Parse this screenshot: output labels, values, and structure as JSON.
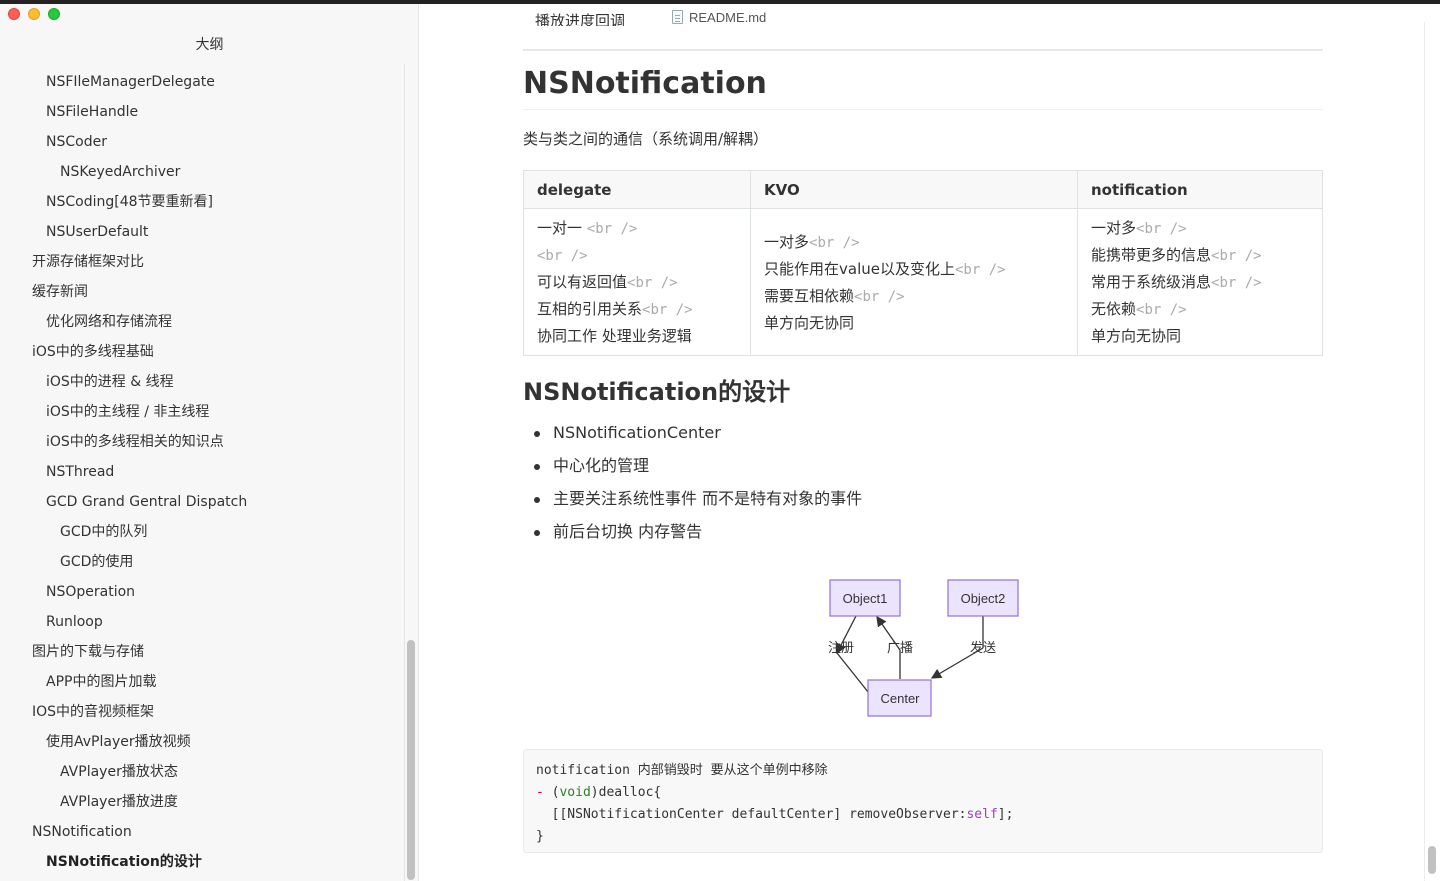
{
  "sidebar": {
    "title": "大纲",
    "items": [
      {
        "label": "NSFIleManagerDelegate",
        "level": 2
      },
      {
        "label": "NSFileHandle",
        "level": 2
      },
      {
        "label": "NSCoder",
        "level": 2
      },
      {
        "label": "NSKeyedArchiver",
        "level": 3
      },
      {
        "label": "NSCoding[48节要重新看]",
        "level": 2
      },
      {
        "label": "NSUserDefault",
        "level": 2
      },
      {
        "label": "开源存储框架对比",
        "level": 1
      },
      {
        "label": "缓存新闻",
        "level": 1
      },
      {
        "label": "优化网络和存储流程",
        "level": 2
      },
      {
        "label": "iOS中的多线程基础",
        "level": 1
      },
      {
        "label": "iOS中的进程 & 线程",
        "level": 2
      },
      {
        "label": "iOS中的主线程 / 非主线程",
        "level": 2
      },
      {
        "label": "iOS中的多线程相关的知识点",
        "level": 2
      },
      {
        "label": "NSThread",
        "level": 2
      },
      {
        "label": "GCD Grand Gentral Dispatch",
        "level": 2
      },
      {
        "label": "GCD中的队列",
        "level": 3
      },
      {
        "label": "GCD的使用",
        "level": 3
      },
      {
        "label": "NSOperation",
        "level": 2
      },
      {
        "label": "Runloop",
        "level": 2
      },
      {
        "label": "图片的下载与存储",
        "level": 1
      },
      {
        "label": "APP中的图片加载",
        "level": 2
      },
      {
        "label": "IOS中的音视频框架",
        "level": 1
      },
      {
        "label": "使用AvPlayer播放视频",
        "level": 2
      },
      {
        "label": "AVPlayer播放状态",
        "level": 3
      },
      {
        "label": "AVPlayer播放进度",
        "level": 3
      },
      {
        "label": "NSNotification",
        "level": 1
      },
      {
        "label": "NSNotification的设计",
        "level": 2,
        "active": true
      }
    ]
  },
  "tab": {
    "filename": "README.md"
  },
  "main": {
    "cut_text": "播放进度回调",
    "h1": "NSNotification",
    "intro": "类与类之间的通信（系统调用/解耦）",
    "table": {
      "headers": [
        "delegate",
        "KVO",
        "notification"
      ],
      "br": "<br />",
      "columns": [
        {
          "lines": [
            {
              "t": "一对一 ",
              "br": true
            },
            {
              "t": "",
              "br": true
            },
            {
              "t": "可以有返回值",
              "br": true
            },
            {
              "t": "互相的引用关系",
              "br": true
            },
            {
              "t": "协同工作 处理业务逻辑",
              "br": false
            }
          ]
        },
        {
          "lines": [
            {
              "t": "一对多",
              "br": true
            },
            {
              "t": "只能作用在value以及变化上",
              "br": true
            },
            {
              "t": "需要互相依赖",
              "br": true
            },
            {
              "t": "单方向无协同",
              "br": false
            }
          ]
        },
        {
          "lines": [
            {
              "t": "一对多",
              "br": true
            },
            {
              "t": "能携带更多的信息",
              "br": true
            },
            {
              "t": "常用于系统级消息",
              "br": true
            },
            {
              "t": "无依赖",
              "br": true
            },
            {
              "t": "单方向无协同",
              "br": false
            }
          ]
        }
      ]
    },
    "h2": "NSNotification的设计",
    "bullets": [
      "NSNotificationCenter",
      "中心化的管理",
      "主要关注系统性事件 而不是特有对象的事件",
      "前后台切换 内存警告"
    ],
    "diagram": {
      "nodes": {
        "object1": "Object1",
        "object2": "Object2",
        "center": "Center"
      },
      "edges": {
        "register": "注册",
        "broadcast": "广播",
        "send": "发送"
      },
      "colors": {
        "node_fill": "#ece4ff",
        "node_stroke": "#9370db"
      }
    },
    "code": {
      "comment": "notification 内部销毁时 要从这个单例中移除",
      "minus": "-",
      "void": "void",
      "sig_tail": "dealloc{",
      "call_head": "  [[NSNotificationCenter defaultCenter] removeObserver:",
      "self": "self",
      "call_tail": "];",
      "close": "}"
    }
  }
}
